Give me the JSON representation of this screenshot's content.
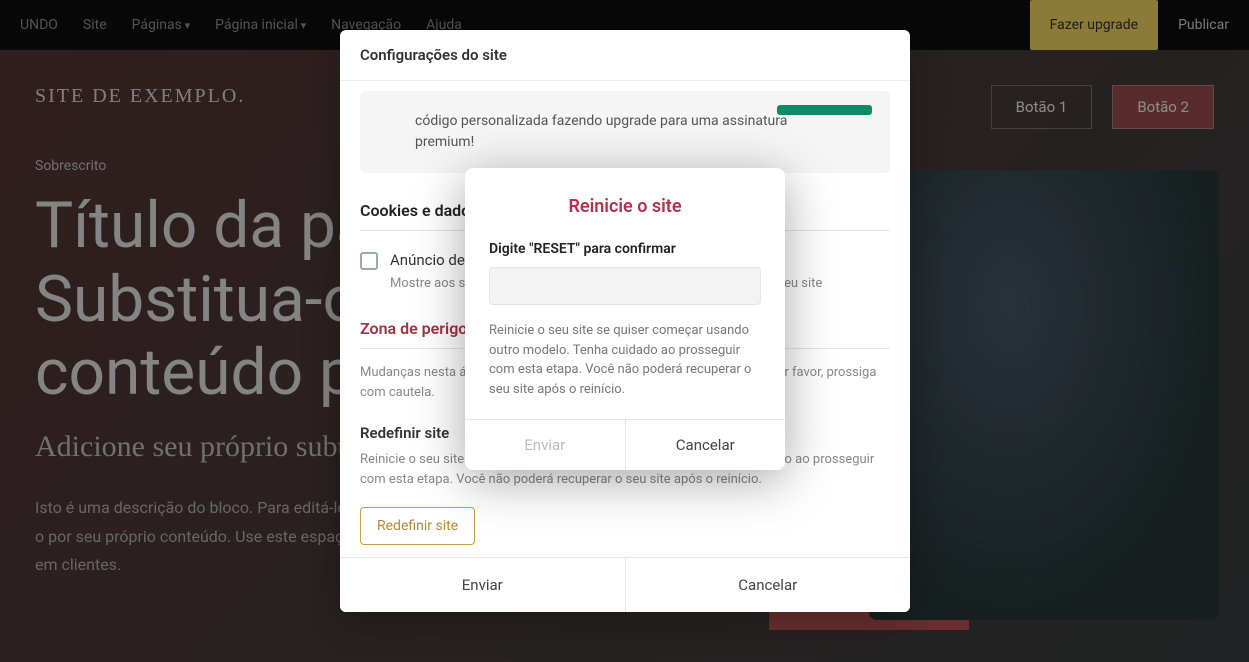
{
  "topbar": {
    "undo": "UNDO",
    "site": "Site",
    "pages": "Páginas",
    "page_dropdown": "Página inicial",
    "navigation": "Navegação",
    "help": "Ajuda",
    "upgrade": "Fazer upgrade",
    "publish": "Publicar"
  },
  "site": {
    "logo": "SITE DE EXEMPLO.",
    "button1": "Botão 1",
    "button2": "Botão 2",
    "overscript": "Sobrescrito",
    "title_line1": "Título da página!",
    "title_line2": "Substitua-o por seu",
    "title_line3": "conteúdo próprio.",
    "subtitle": "Adicione seu próprio subtítulo aqui.",
    "desc": "Isto é uma descrição do bloco. Para editá-lo, clique e digite o texto e substitua-o por seu próprio conteúdo. Use este espaço para converter visitantes do site em clientes."
  },
  "settings_modal": {
    "title": "Configurações do site",
    "promo_text": "código personalizada fazendo upgrade para uma assinatura premium!",
    "cookies_section": "Cookies e dados",
    "cookie_checkbox_label": "Anúncio de cookies",
    "cookie_checkbox_desc": "Mostre aos seus visitantes um anúncio sobre o uso de cookies em seu site",
    "danger_title": "Zona de perigo",
    "danger_desc": "Mudanças nesta área podem resultar em perda de dados permanente. Por favor, prossiga com cautela.",
    "redefine_title": "Redefinir site",
    "redefine_desc": "Reinicie o seu site se quiser começar usando outro modelo. Tenha cuidado ao prosseguir com esta etapa. Você não poderá recuperar o seu site após o reinício.",
    "redefine_button": "Redefinir site",
    "submit": "Enviar",
    "cancel": "Cancelar"
  },
  "confirm_modal": {
    "title": "Reinicie o site",
    "label": "Digite \"RESET\" para confirmar",
    "input_value": "",
    "desc": "Reinicie o seu site se quiser começar usando outro modelo. Tenha cuidado ao prosseguir com esta etapa. Você não poderá recuperar o seu site após o reinício.",
    "submit": "Enviar",
    "cancel": "Cancelar"
  }
}
